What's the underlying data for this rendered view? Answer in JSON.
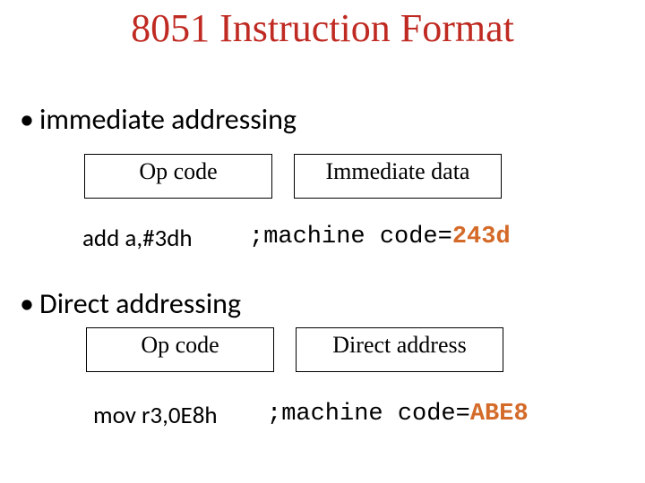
{
  "title": "8051 Instruction Format",
  "sections": [
    {
      "bullet": "immediate addressing",
      "box_left": "Op code",
      "box_right": "Immediate data",
      "asm": "add a,#3dh",
      "comment_prefix": ";machine code=",
      "comment_hex": "243d"
    },
    {
      "bullet": "Direct addressing",
      "box_left": "Op code",
      "box_right": "Direct address",
      "asm": "mov r3,0E8h",
      "comment_prefix": ";machine code=",
      "comment_hex": "ABE8"
    }
  ]
}
